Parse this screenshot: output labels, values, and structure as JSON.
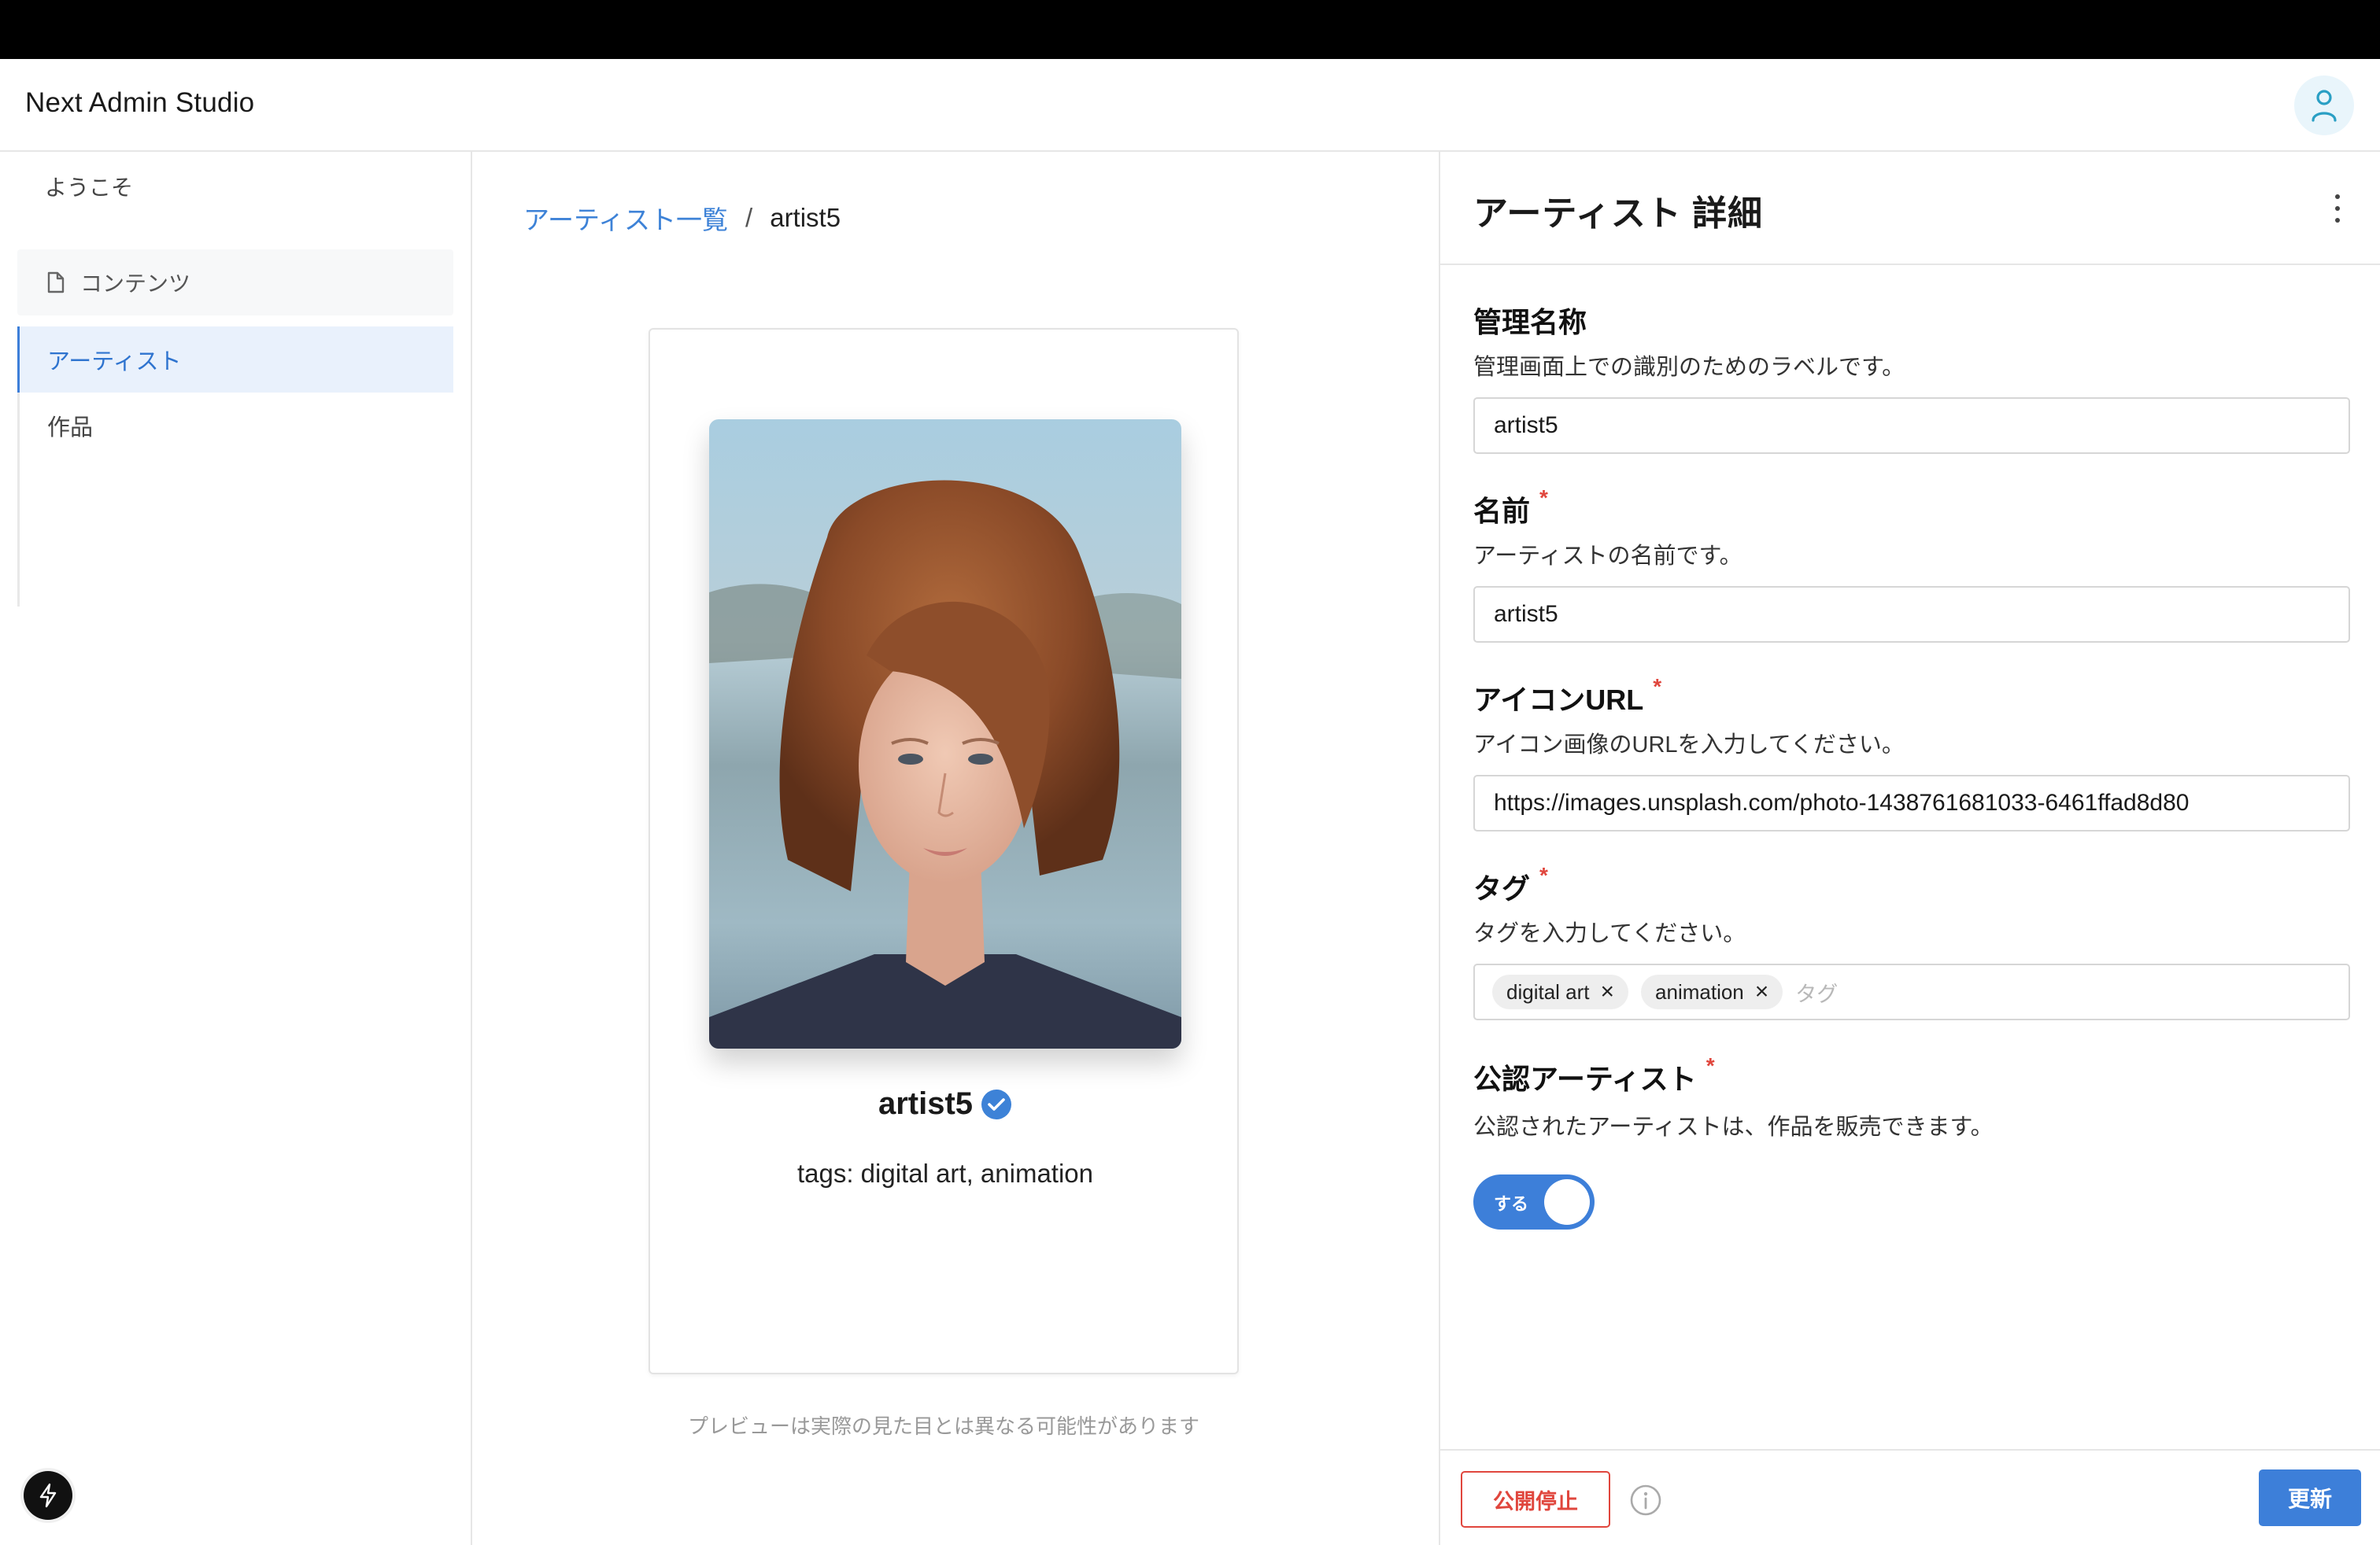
{
  "app": {
    "title": "Next Admin Studio"
  },
  "sidebar": {
    "welcome": "ようこそ",
    "group": {
      "label": "コンテンツ",
      "icon": "document-icon"
    },
    "items": [
      {
        "label": "アーティスト",
        "active": true
      },
      {
        "label": "作品",
        "active": false
      }
    ]
  },
  "breadcrumb": {
    "link": "アーティスト一覧",
    "separator": "/",
    "current": "artist5"
  },
  "preview": {
    "name": "artist5",
    "verified_icon": "verified-badge-icon",
    "tags_line": "tags: digital art, animation",
    "note": "プレビューは実際の見た目とは異なる可能性があります"
  },
  "drawer": {
    "title": "アーティスト 詳細",
    "fields": {
      "admin_name": {
        "label": "管理名称",
        "description": "管理画面上での識別のためのラベルです。",
        "value": "artist5"
      },
      "name": {
        "label": "名前",
        "required": "*",
        "description": "アーティストの名前です。",
        "value": "artist5"
      },
      "icon_url": {
        "label": "アイコンURL",
        "required": "*",
        "description": "アイコン画像のURLを入力してください。",
        "value": "https://images.unsplash.com/photo-1438761681033-6461ffad8d80"
      },
      "tags": {
        "label": "タグ",
        "required": "*",
        "description": "タグを入力してください。",
        "chips": [
          "digital art",
          "animation"
        ],
        "placeholder": "タグ"
      },
      "verified": {
        "label": "公認アーティスト",
        "required": "*",
        "description": "公認されたアーティストは、作品を販売できます。",
        "toggle_label": "する",
        "on": true
      }
    },
    "footer": {
      "unpublish": "公開停止",
      "update": "更新"
    }
  },
  "colors": {
    "accent": "#3d7fd9",
    "danger": "#e0463d"
  }
}
